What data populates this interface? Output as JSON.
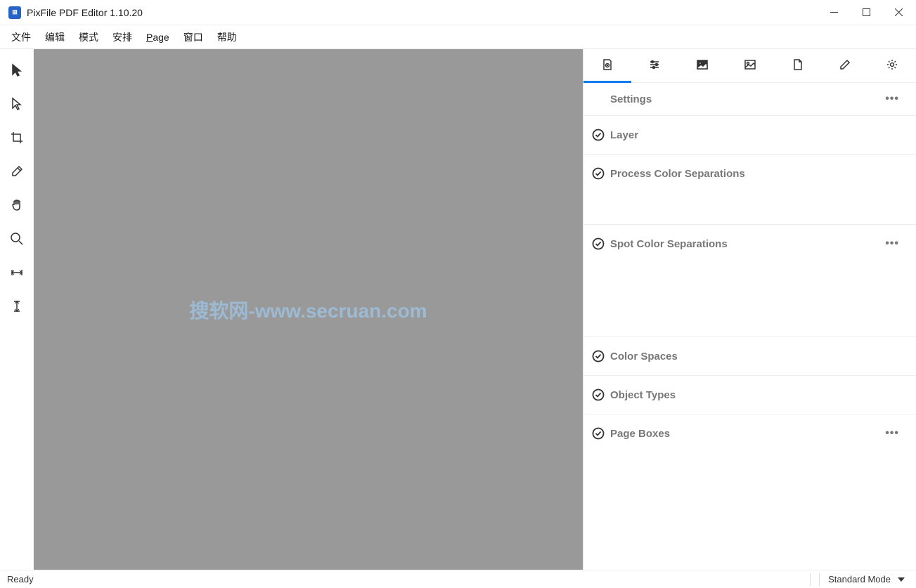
{
  "title": "PixFile PDF Editor 1.10.20",
  "menu": {
    "file": "文件",
    "edit": "编辑",
    "mode": "模式",
    "arrange": "安排",
    "page": "Page",
    "window": "窗口",
    "help": "帮助"
  },
  "watermark": "搜软网-www.secruan.com",
  "panel": {
    "header": "Settings",
    "sections": {
      "layer": "Layer",
      "process": "Process Color Separations",
      "spot": "Spot Color Separations",
      "cspaces": "Color Spaces",
      "otypes": "Object Types",
      "pboxes": "Page Boxes"
    }
  },
  "status": {
    "ready": "Ready",
    "mode": "Standard Mode"
  }
}
